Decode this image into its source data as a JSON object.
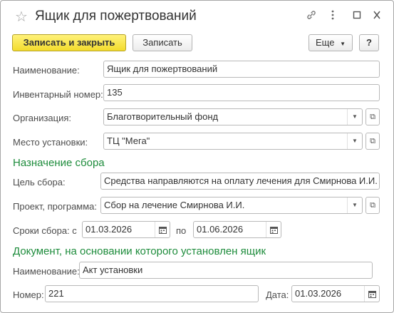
{
  "window": {
    "title": "Ящик для пожертвований",
    "icons": [
      "star-icon",
      "link-icon",
      "more-vertical-icon",
      "minimize-icon",
      "close-icon"
    ]
  },
  "toolbar": {
    "save_close_label": "Записать и закрыть",
    "save_label": "Записать",
    "more_label": "Еще",
    "help_label": "?"
  },
  "form": {
    "name_label": "Наименование:",
    "name_value": "Ящик для пожертвований",
    "inventory_label": "Инвентарный номер:",
    "inventory_value": "135",
    "org_label": "Организация:",
    "org_value": "Благотворительный фонд",
    "place_label": "Место установки:",
    "place_value": "ТЦ \"Мега\""
  },
  "purpose": {
    "section_title": "Назначение сбора",
    "goal_label": "Цель сбора:",
    "goal_value": "Средства направляются на оплату лечения для Смирнова И.И.",
    "project_label": "Проект, программа:",
    "project_value": "Сбор на лечение Смирнова И.И.",
    "period_label": "Сроки сбора: с",
    "date_from": "01.03.2026",
    "to_label": "по",
    "date_to": "01.06.2026"
  },
  "basis": {
    "section_title": "Документ, на основании которого установлен ящик",
    "name_label": "Наименование:",
    "name_value": "Акт установки",
    "number_label": "Номер:",
    "number_value": "221",
    "date_label": "Дата:",
    "date_value": "01.03.2026"
  },
  "colors": {
    "primary_button": "#f3dc2c",
    "section_title": "#1e8c3c"
  }
}
